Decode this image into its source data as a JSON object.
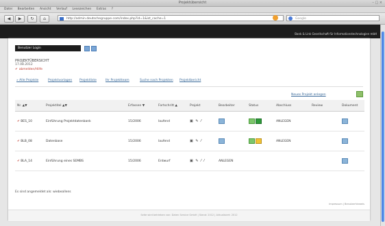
{
  "window": {
    "title": "Projektübersicht",
    "controls": "– □ ×"
  },
  "menu": [
    "Datei",
    "Bearbeiten",
    "Ansicht",
    "Verlauf",
    "Lesezeichen",
    "Extras",
    "?"
  ],
  "nav": {
    "back": "◀",
    "forward": "▶",
    "reload": "↻",
    "home": "⌂",
    "url": "http://admin.deutschegruppe.com/index.php?id=1&ist_cache=1",
    "search_placeholder": "Google"
  },
  "site": {
    "tagline": "Bank & Link Gesellschaft für Informationstechnologien mbH"
  },
  "user": {
    "login_label": "Benutzer Login"
  },
  "page": {
    "title": "PROJEKTÜBERSICHT",
    "date": "17.08.2012",
    "logout": "abmelden/Hilfe"
  },
  "tabs": [
    "» Alle Projekte",
    "Projektvorlagen",
    "Projektliste",
    "Ihr Projektteam",
    "Suche nach Projekten",
    "Projektbericht"
  ],
  "actions": {
    "new_project": "Neues Projekt anlegen"
  },
  "table": {
    "headers": [
      "Nr. ▲▼",
      "Projektitel ▲▼",
      "Erfassen ▼",
      "Fortschritt ▲",
      "Projekt",
      "Bearbeiter",
      "Status",
      "Abschluss",
      "Review",
      "Dokument"
    ],
    "rows": [
      {
        "nr": "BES_10",
        "title": "Einführung Projektdatenbank",
        "date": "15/2006",
        "progress": "laufend",
        "tools": "▣ ✎ ⁄",
        "owner": "",
        "deadline": "ANLEGEN"
      },
      {
        "nr": "BLB_08",
        "title": "Datenbase",
        "date": "15/2006",
        "progress": "laufend",
        "tools": "▣ ✎ ⁄",
        "owner": "",
        "deadline": "ANLEGEN"
      },
      {
        "nr": "BLA_14",
        "title": "Einführung eines SEMBS",
        "date": "15/2006",
        "progress": "Entwurf",
        "tools": "▣ ✎ ⁄ ⁄",
        "owner": "ANLEGEN",
        "deadline": ""
      }
    ]
  },
  "status": {
    "no_entries": "Es sind angemeldet als: wiebeallens"
  },
  "footer": {
    "impress": "Impressum  |  Benutzerhinweis",
    "text": "Seite wird betrieben von: Daten Service GmbH  |  Stand: 2012  |  Aktualisiert: 2012"
  }
}
